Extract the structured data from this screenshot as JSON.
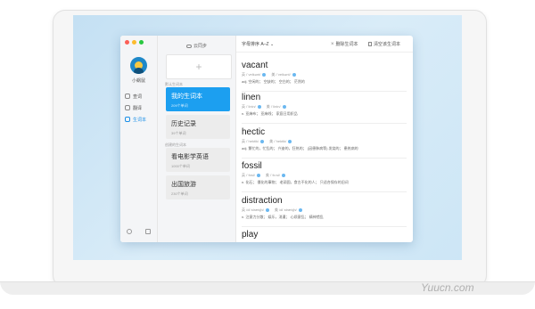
{
  "app": {
    "user": {
      "name": "小蜗鼠"
    },
    "nav": [
      {
        "label": "查词",
        "icon": "search-icon"
      },
      {
        "label": "翻译",
        "icon": "link-icon"
      },
      {
        "label": "生词本",
        "icon": "book-icon",
        "active": true
      }
    ],
    "bottom_icons": [
      "settings-icon",
      "window-icon"
    ]
  },
  "lists_panel": {
    "sync_label": "云同步",
    "add_symbol": "+",
    "default_section": "默认生词本",
    "created_section": "创建的生词本",
    "lists": [
      {
        "name": "我的生词本",
        "count": "209个单词",
        "active": true
      },
      {
        "name": "历史记录",
        "count": "39个单词"
      },
      {
        "name": "看电影学英语",
        "count": "1000个单词"
      },
      {
        "name": "出国旅游",
        "count": "230个单词"
      }
    ]
  },
  "toolbar": {
    "sort_label": "字母排序 A–Z",
    "delete_label": "删除生词本",
    "clear_label": "清空该生词本"
  },
  "entries": [
    {
      "word": "vacant",
      "uk": "英 /ˈveikənt/",
      "us": "美 /ˈveikənt/",
      "def": "adj. 空闲的；  空缺的；  空白的；  茫然的"
    },
    {
      "word": "linen",
      "uk": "英 /ˈlinin/",
      "us": "美 /ˈlinin/",
      "def": "n. 亚麻布；  亚麻线；  家庭日用织品"
    },
    {
      "word": "hectic",
      "uk": "英 /ˈhektik/",
      "us": "美 /ˈhektik/",
      "def": "adj. 繁忙的，忙乱的；  兴奋的，狂热的；  (因患肺病等) 发烧的；  患热病的"
    },
    {
      "word": "fossil",
      "uk": "英 /ˈfɒsl/",
      "us": "美 /ˈfɑːsl/",
      "def": "n. 化石；  僵化的事物；  老顽固，食古不化的人；  只适合保存的旧词"
    },
    {
      "word": "distraction",
      "uk": "英 /diˈstrækʃn/",
      "us": "美 /diˈstrækʃn/",
      "def": "n. 注意力分散；  娱乐，消遣；  心烦意乱；  精神错乱"
    },
    {
      "word": "play",
      "uk": "",
      "us": "",
      "def": ""
    }
  ],
  "watermark": "Yuucn.com"
}
